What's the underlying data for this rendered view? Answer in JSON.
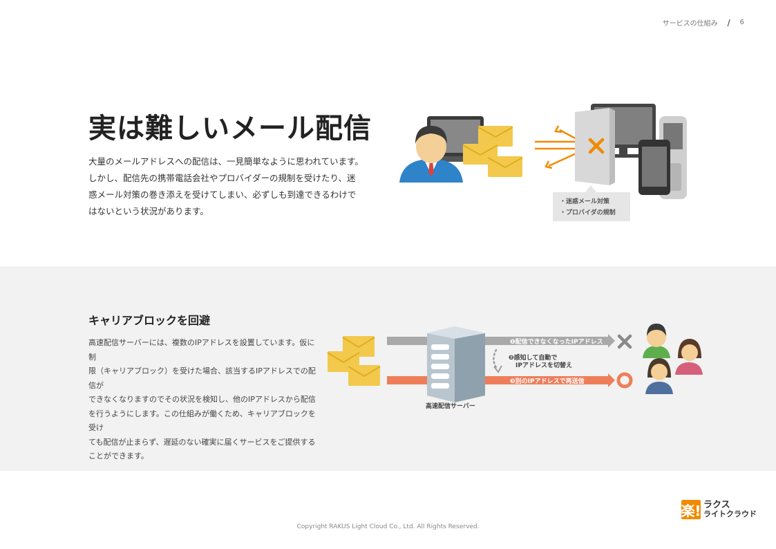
{
  "header": {
    "section": "サービスの仕組み",
    "separator": "/",
    "page": "6"
  },
  "hero": {
    "title": "実は難しいメール配信",
    "lines": [
      "大量のメールアドレスへの配信は、一見簡単なように思われています。",
      "しかし、配信先の携帯電話会社やプロバイダーの規制を受けたり、迷",
      "惑メール対策の巻き添えを受けてしまい、必ずしも到達できるわけで",
      "はないという状況があります。"
    ],
    "callout": [
      "・迷惑メール対策",
      "・プロバイダの規制"
    ]
  },
  "carrier": {
    "title": "キャリアブロックを回避",
    "lines": [
      "高速配信サーバーには、複数のIPアドレスを設置しています。仮に制",
      "限（キャリアブロック）を受けた場合、該当するIPアドレスでの配信が",
      "できなくなりますのでその状況を検知し、他のIPアドレスから配信",
      "を行うようにします。この仕組みが働くため、キャリアブロックを受け",
      "ても配信が止まらず、遅延のない確実に届くサービスをご提供する",
      "ことができます。"
    ],
    "step1": "❶配信できなくなったIPアドレス",
    "step2_line1": "❷感知して自動で",
    "step2_line2": "IPアドレスを切替え",
    "step3": "❸別のIPアドレスで再送信",
    "server_label": "高速配信サーバー"
  },
  "footer": {
    "copyright": "Copyright RAKUS Light Cloud Co., Ltd. All Rights Reserved.",
    "logo_mark": "楽!",
    "logo_line1": "ラクス",
    "logo_line2": "ライトクラウド"
  },
  "colors": {
    "orange": "#f08a00",
    "arrow_orange": "#ee7e5a",
    "grey_arrow": "#a9a9a9",
    "envelope": "#f2c94c",
    "band_bg": "#f1f2f1"
  }
}
